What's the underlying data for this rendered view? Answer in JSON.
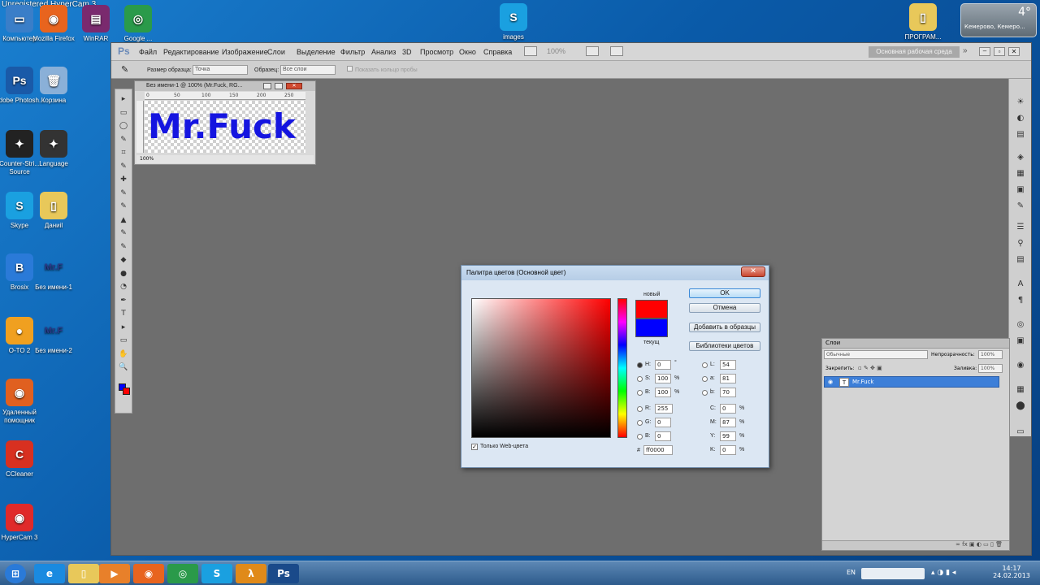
{
  "watermark": "Unregistered HyperCam 3",
  "desktop_icons": [
    {
      "label": "Компьютер",
      "icon": "computer-icon",
      "color": "#3a7ec8",
      "glyph": "▭"
    },
    {
      "label": "Mozilla Firefox",
      "icon": "firefox-icon",
      "color": "#e8641e",
      "glyph": "◉"
    },
    {
      "label": "WinRAR",
      "icon": "winrar-icon",
      "color": "#7a2a6e",
      "glyph": "▤"
    },
    {
      "label": "Google ...",
      "icon": "chrome-icon",
      "color": "#2a9a4a",
      "glyph": "◎"
    },
    {
      "label": "Adobe Photosh...",
      "icon": "photoshop-icon",
      "color": "#1a5aa8",
      "glyph": "Ps"
    },
    {
      "label": "Корзина",
      "icon": "recycle-bin-icon",
      "color": "#8ab0d8",
      "glyph": "🗑"
    },
    {
      "label": "Counter-Stri... Source",
      "icon": "counter-strike-icon",
      "color": "#222222",
      "glyph": "✦"
    },
    {
      "label": "Language",
      "icon": "language-icon",
      "color": "#333333",
      "glyph": "✦"
    },
    {
      "label": "Skype",
      "icon": "skype-icon",
      "color": "#1aa0e0",
      "glyph": "S"
    },
    {
      "label": "Даниil",
      "icon": "folder-icon",
      "color": "#e8c85a",
      "glyph": "▯"
    },
    {
      "label": "Brosix",
      "icon": "brosix-icon",
      "color": "#2a7ad8",
      "glyph": "B"
    },
    {
      "label": "Без имени-1",
      "icon": "image-file-icon",
      "color": "transparent",
      "glyph": "Mr.F"
    },
    {
      "label": "O-TO 2",
      "icon": "app-icon",
      "color": "#f0a020",
      "glyph": "●"
    },
    {
      "label": "Без имени-2",
      "icon": "image-file-icon",
      "color": "transparent",
      "glyph": "Mr.F"
    },
    {
      "label": "Удаленный помощник",
      "icon": "remote-assist-icon",
      "color": "#e06020",
      "glyph": "◉"
    },
    {
      "label": "CCleaner",
      "icon": "ccleaner-icon",
      "color": "#d83020",
      "glyph": "C"
    },
    {
      "label": "HyperCam 3",
      "icon": "hypercam-icon",
      "color": "#e02a2a",
      "glyph": "◉"
    }
  ],
  "desktop_top_icons": [
    {
      "label": "images",
      "icon": "skype-icon",
      "color": "#1aa0e0",
      "glyph": "S"
    },
    {
      "label": "ПРОГРАМ...",
      "icon": "folder-icon",
      "color": "#e8c85a",
      "glyph": "▯"
    }
  ],
  "weather": {
    "temp": "4°",
    "city": "Кемерово, Кемеро..."
  },
  "photoshop": {
    "logo": "Ps",
    "menu": [
      "Файл",
      "Редактирование",
      "Изображение",
      "Слои",
      "Выделение",
      "Фильтр",
      "Анализ",
      "3D",
      "Просмотр",
      "Окно",
      "Справка"
    ],
    "zoom": "100%",
    "workspace": "Основная рабочая среда",
    "options": {
      "sample_size_label": "Размер образца:",
      "sample_size_value": "Точка",
      "sample_label": "Образец:",
      "sample_value": "Все слои",
      "show_ring": "Показать кольцо пробы"
    },
    "document": {
      "title": "Без имени-1 @ 100% (Mr.Fuck, RG...",
      "canvas_text": "Mr.Fuck",
      "zoom": "100%",
      "ruler": [
        "0",
        "50",
        "100",
        "150",
        "200",
        "250"
      ]
    },
    "color_dialog": {
      "title": "Палитра цветов (Основной цвет)",
      "new_label": "новый",
      "current_label": "текущ",
      "new_color": "#ff0000",
      "current_color": "#0000ff",
      "buttons": {
        "ok": "OK",
        "cancel": "Отмена",
        "add_swatch": "Добавить в образцы",
        "libraries": "Библиотеки цветов"
      },
      "web_only": "Только Web-цвета",
      "fields": {
        "H": "0",
        "S": "100",
        "Bv": "100",
        "R": "255",
        "G": "0",
        "Bc": "0",
        "L": "54",
        "a": "81",
        "b": "70",
        "C": "0",
        "M": "87",
        "Y": "99",
        "K": "0",
        "hex": "ff0000"
      },
      "units": {
        "deg": "°",
        "pct": "%"
      }
    },
    "layers_panel": {
      "title": "Слои",
      "blend_mode": "Обычные",
      "opacity_label": "Непрозрачность:",
      "opacity": "100%",
      "lock_label": "Закрепить:",
      "fill_label": "Заливка:",
      "fill": "100%",
      "layer_name": "Mr.Fuck",
      "layer_glyph": "T"
    }
  },
  "taskbar": {
    "lang": "EN",
    "time": "14:17",
    "date": "24.02.2013",
    "apps": [
      {
        "icon": "start-orb-icon",
        "color": "#2a7ad8",
        "glyph": "⊞"
      },
      {
        "icon": "ie-icon",
        "color": "#1a8ae0",
        "glyph": "e"
      },
      {
        "icon": "explorer-icon",
        "color": "#e8c85a",
        "glyph": "▯"
      },
      {
        "icon": "media-player-icon",
        "color": "#e8802a",
        "glyph": "▶"
      },
      {
        "icon": "firefox-icon",
        "color": "#e8641e",
        "glyph": "◉"
      },
      {
        "icon": "chrome-icon",
        "color": "#2a9a4a",
        "glyph": "◎"
      },
      {
        "icon": "skype-icon",
        "color": "#1aa0e0",
        "glyph": "S"
      },
      {
        "icon": "halflife-icon",
        "color": "#e08a1a",
        "glyph": "λ"
      },
      {
        "icon": "photoshop-icon",
        "color": "#1a4a8a",
        "glyph": "Ps"
      }
    ]
  }
}
